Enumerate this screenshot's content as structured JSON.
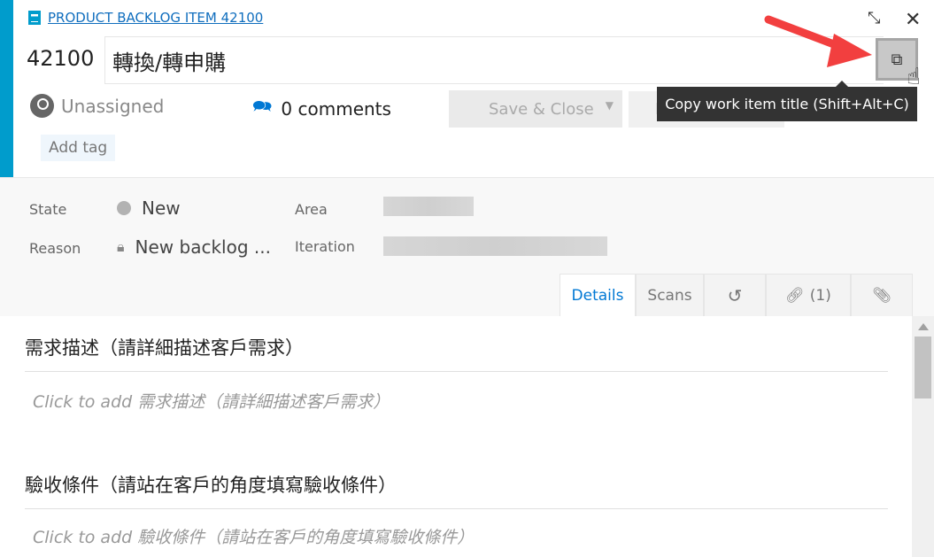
{
  "header": {
    "type_link": "PRODUCT BACKLOG ITEM 42100",
    "id": "42100",
    "title": "轉換/轉申購",
    "assigned_to": "Unassigned",
    "comments": "0 comments",
    "save_close": "Save & Close",
    "follow": "Follow",
    "add_tag": "Add tag",
    "tooltip": "Copy work item title (Shift+Alt+C)",
    "accent_color": "#009ccc"
  },
  "fields": {
    "state_label": "State",
    "state_value": "New",
    "reason_label": "Reason",
    "reason_value": "New backlog ...",
    "area_label": "Area",
    "iteration_label": "Iteration"
  },
  "tabs": [
    {
      "label": "Details",
      "active": true
    },
    {
      "label": "Scans"
    },
    {
      "icon": "history-icon"
    },
    {
      "icon": "link-icon",
      "label": "(1)"
    },
    {
      "icon": "paperclip-icon"
    }
  ],
  "sections": [
    {
      "title": "需求描述（請詳細描述客戶需求）",
      "placeholder": "Click to add 需求描述（請詳細描述客戶需求）"
    },
    {
      "title": "驗收條件（請站在客戶的角度填寫驗收條件）",
      "placeholder": "Click to add 驗收條件（請站在客戶的角度填寫驗收條件）"
    }
  ]
}
